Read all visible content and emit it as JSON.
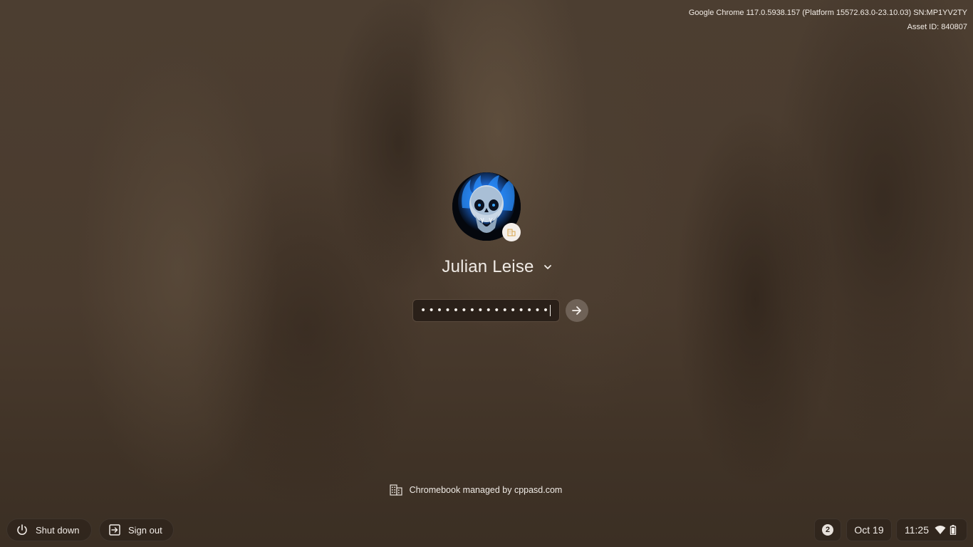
{
  "system_info": {
    "version_line": "Google Chrome 117.0.5938.157 (Platform 15572.63.0-23.10.03) SN:MP1YV2TY",
    "asset_line": "Asset ID: 840807"
  },
  "user": {
    "name": "Julian Leise",
    "avatar_icon": "skull-avatar",
    "badge_icon": "enterprise-badge-icon"
  },
  "password": {
    "masked_value": "••••••••••••••••",
    "submit_icon": "arrow-right-icon"
  },
  "management": {
    "text": "Chromebook managed by cppasd.com",
    "icon": "building-icon"
  },
  "shelf": {
    "shutdown_label": "Shut down",
    "signout_label": "Sign out"
  },
  "tray": {
    "notification_count": "2",
    "date": "Oct 19",
    "time": "11:25",
    "wifi_icon": "wifi-icon",
    "battery_icon": "battery-icon"
  },
  "colors": {
    "text": "#f0ebe6",
    "field_bg": "#2a2019",
    "submit_bg": "#6f6257",
    "avatar_flame": "#2f8cff"
  }
}
